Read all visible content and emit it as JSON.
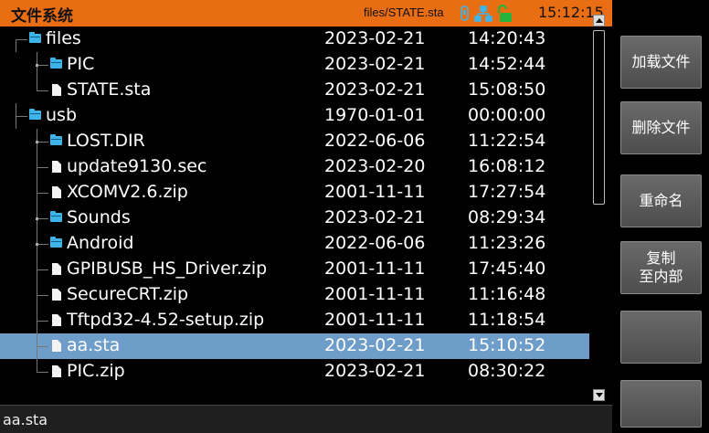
{
  "header": {
    "title": "文件系统",
    "path": "files/STATE.sta",
    "time": "15:12:15",
    "colors": {
      "bar": "#e96e13",
      "usb_icon": "#3fb4e9",
      "network_icon": "#3fb4e9",
      "lock_icon": "#28b43c"
    }
  },
  "files": [
    {
      "name": "files",
      "type": "folder",
      "date": "2023-02-21",
      "time": "14:20:43"
    },
    {
      "name": "PIC",
      "type": "folder",
      "date": "2023-02-21",
      "time": "14:52:44"
    },
    {
      "name": "STATE.sta",
      "type": "file",
      "date": "2023-02-21",
      "time": "15:08:50"
    },
    {
      "name": "usb",
      "type": "folder",
      "date": "1970-01-01",
      "time": "00:00:00"
    },
    {
      "name": "LOST.DIR",
      "type": "folder",
      "date": "2022-06-06",
      "time": "11:22:54"
    },
    {
      "name": "update9130.sec",
      "type": "file",
      "date": "2023-02-20",
      "time": "16:08:12"
    },
    {
      "name": "XCOMV2.6.zip",
      "type": "file",
      "date": "2001-11-11",
      "time": "17:27:54"
    },
    {
      "name": "Sounds",
      "type": "folder",
      "date": "2023-02-21",
      "time": "08:29:34"
    },
    {
      "name": "Android",
      "type": "folder",
      "date": "2022-06-06",
      "time": "11:23:26"
    },
    {
      "name": "GPIBUSB_HS_Driver.zip",
      "type": "file",
      "date": "2001-11-11",
      "time": "17:45:40"
    },
    {
      "name": "SecureCRT.zip",
      "type": "file",
      "date": "2001-11-11",
      "time": "11:16:48"
    },
    {
      "name": "Tftpd32-4.52-setup.zip",
      "type": "file",
      "date": "2001-11-11",
      "time": "11:18:54"
    },
    {
      "name": "aa.sta",
      "type": "file",
      "date": "2023-02-21",
      "time": "15:10:52",
      "selected": true
    },
    {
      "name": "PIC.zip",
      "type": "file",
      "date": "2023-02-21",
      "time": "08:30:22"
    }
  ],
  "status": {
    "selected_file": "aa.sta"
  },
  "softkeys": {
    "load": "加载文件",
    "delete": "删除文件",
    "rename": "重命名",
    "copy_line1": "复制",
    "copy_line2": "至内部",
    "blank5": "",
    "blank6": ""
  },
  "selection_color": "#6f9dc9"
}
